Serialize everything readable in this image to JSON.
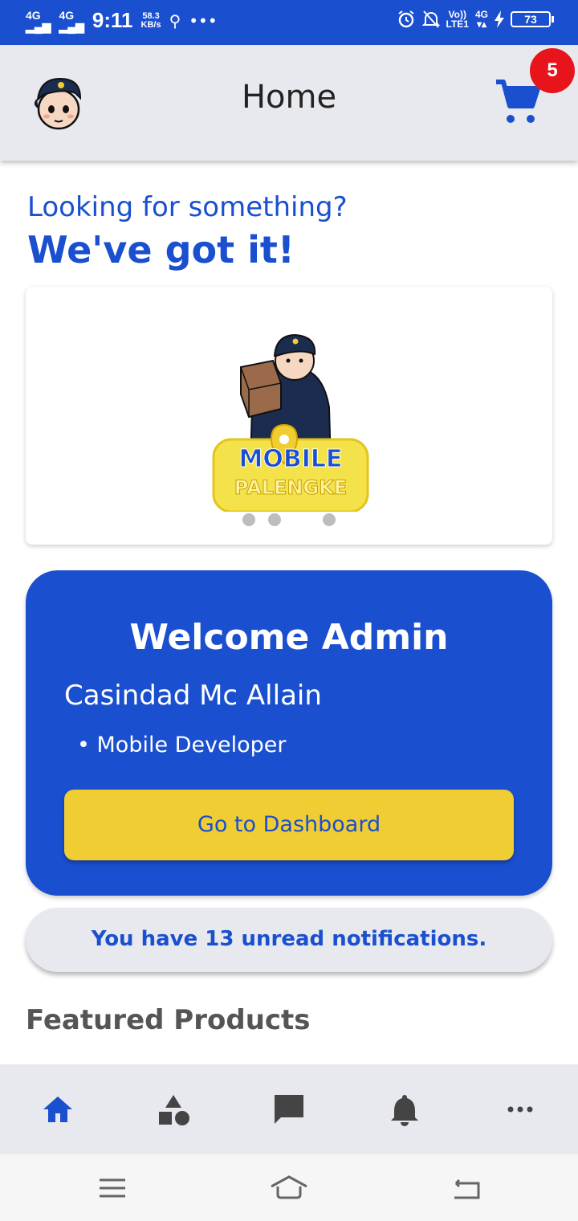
{
  "status_bar": {
    "signal1": "4G",
    "signal2": "4G",
    "time": "9:11",
    "speed_value": "58.3",
    "speed_unit": "KB/s",
    "more": "•••",
    "volte_top": "Vo))",
    "volte_bottom": "LTE1",
    "net": "4G",
    "battery": "73"
  },
  "app_bar": {
    "title": "Home",
    "cart_count": "5"
  },
  "hero": {
    "line1": "Looking for something?",
    "line2": "We've got it!"
  },
  "carousel": {
    "logo_text_top": "MOBILE",
    "logo_text_bottom": "PALENGKE"
  },
  "welcome": {
    "title": "Welcome Admin",
    "name": "Casindad Mc Allain",
    "role": "• Mobile Developer",
    "button": "Go to Dashboard"
  },
  "notifications": {
    "text": "You have 13 unread notifications."
  },
  "featured": {
    "title": "Featured Products"
  },
  "bottom_nav": {
    "items": [
      "home-icon",
      "categories-icon",
      "chat-icon",
      "bell-icon",
      "more-icon"
    ],
    "active_color": "#1a4fcf",
    "inactive_color": "#444444"
  },
  "colors": {
    "primary": "#1a4fcf",
    "accent": "#f0cd33",
    "badge": "#e8141b"
  }
}
